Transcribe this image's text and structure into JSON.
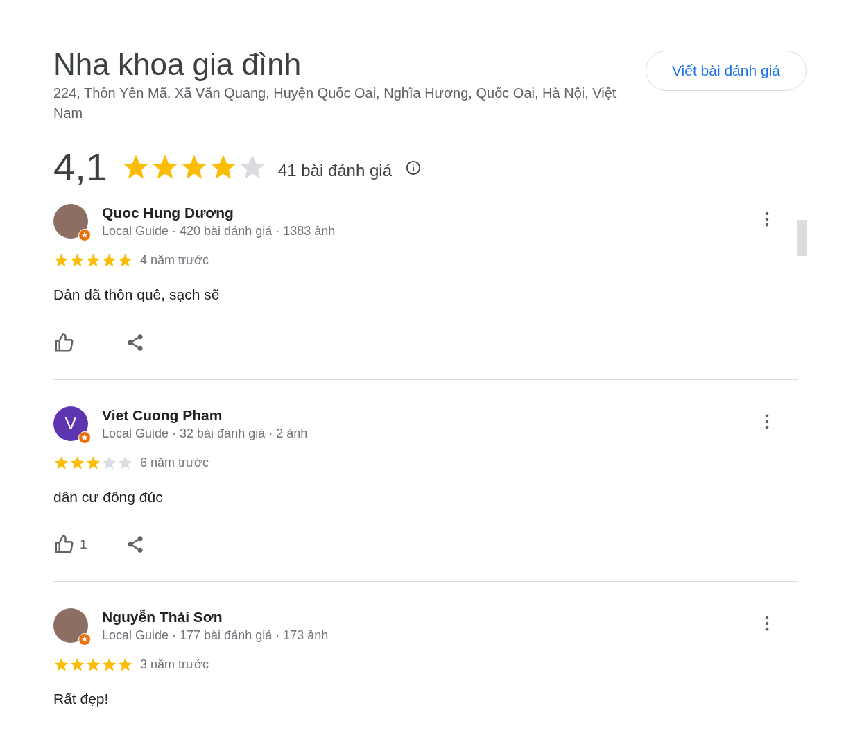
{
  "place": {
    "title": "Nha khoa gia đình",
    "address": "224, Thôn Yên Mã, Xã Văn Quang, Huyện Quốc Oai, Nghĩa Hương, Quốc Oai, Hà Nội, Việt Nam",
    "write_review_button": "Viết bài đánh giá"
  },
  "rating": {
    "score": "4,1",
    "stars": 4,
    "count": "41 bài đánh giá"
  },
  "reviews": [
    {
      "avatar": {
        "kind": "photo"
      },
      "name": "Quoc Hung Dương",
      "meta": "Local Guide · 420 bài đánh giá · 1383 ảnh",
      "stars": 5,
      "time": "4 năm trước",
      "text": "Dân dã thôn quê, sạch sẽ",
      "actions_visible": true
    },
    {
      "avatar": {
        "kind": "letter",
        "letter": "V",
        "color": "#5e35b1"
      },
      "name": "Viet Cuong Pham",
      "meta": "Local Guide · 32 bài đánh giá · 2 ảnh",
      "stars": 3,
      "time": "6 năm trước",
      "text": "dân cư đông đúc",
      "likes": "1",
      "actions_visible": true
    },
    {
      "avatar": {
        "kind": "photo"
      },
      "name": "Nguyễn Thái Sơn",
      "meta": "Local Guide · 177 bài đánh giá · 173 ảnh",
      "stars": 5,
      "time": "3 năm trước",
      "text": "Rất đẹp!",
      "actions_visible": false
    }
  ]
}
